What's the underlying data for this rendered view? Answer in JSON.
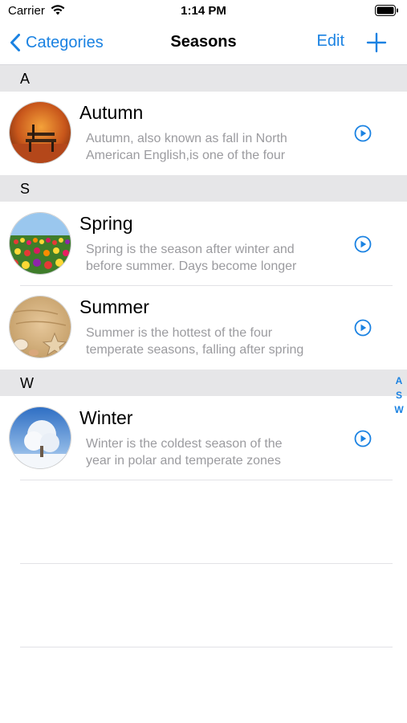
{
  "status_bar": {
    "carrier": "Carrier",
    "time": "1:14 PM"
  },
  "nav": {
    "back_label": "Categories",
    "title": "Seasons",
    "edit_label": "Edit"
  },
  "sections": [
    {
      "letter": "A",
      "items": [
        {
          "title": "Autumn",
          "line1": "Autumn, also known as fall in North",
          "line2": "American English,is one of the four"
        }
      ]
    },
    {
      "letter": "S",
      "items": [
        {
          "title": "Spring",
          "line1": "Spring is the season after winter and",
          "line2": "before summer. Days become longer"
        },
        {
          "title": "Summer",
          "line1": "Summer is the hottest of the four",
          "line2": "temperate seasons, falling after spring"
        }
      ]
    },
    {
      "letter": "W",
      "items": [
        {
          "title": "Winter",
          "line1": "Winter is the coldest season of the",
          "line2": "year in polar and temperate zones"
        }
      ]
    }
  ],
  "index": [
    "A",
    "S",
    "W"
  ],
  "colors": {
    "accent": "#1a82e2",
    "section_background": "#e6e6e8",
    "secondary_text": "#9b9b9f"
  }
}
